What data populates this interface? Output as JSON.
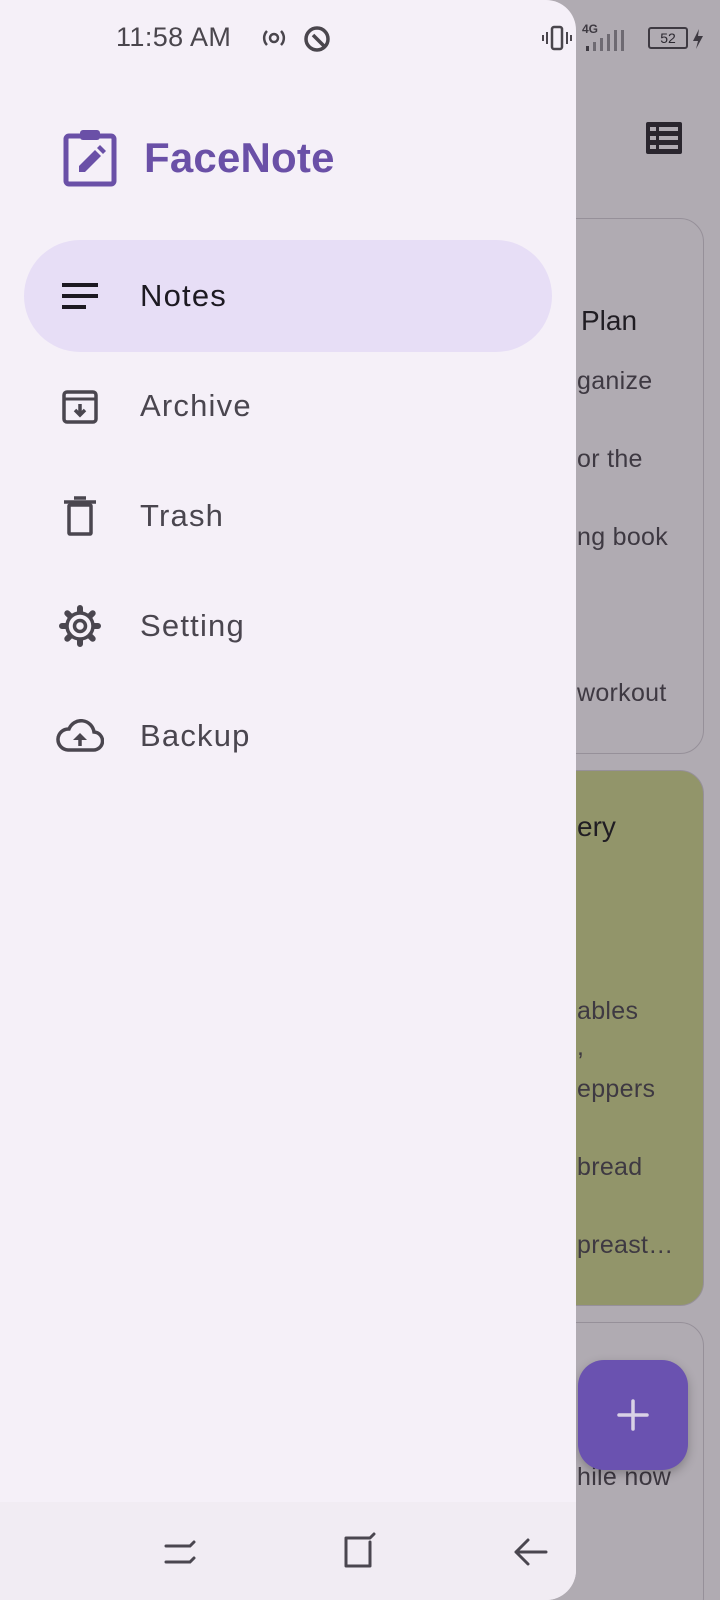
{
  "status_bar": {
    "time": "11:58 AM",
    "network": "4G",
    "battery": "52"
  },
  "drawer": {
    "app_name": "FaceNote",
    "brand_color": "#6a50a7",
    "active_bg": "#e7def6",
    "items": [
      {
        "label": "Notes",
        "icon": "notes-lines-icon",
        "active": true
      },
      {
        "label": "Archive",
        "icon": "archive-icon",
        "active": false
      },
      {
        "label": "Trash",
        "icon": "trash-icon",
        "active": false
      },
      {
        "label": "Setting",
        "icon": "gear-icon",
        "active": false
      },
      {
        "label": "Backup",
        "icon": "cloud-upload-icon",
        "active": false
      }
    ]
  },
  "background": {
    "cards": [
      {
        "title": "Plan",
        "lines": [
          "ganize",
          "or the",
          "ng book",
          "workout"
        ]
      },
      {
        "title": "ery",
        "color": "#c9d18a",
        "lines": [
          "ables",
          ",",
          "eppers",
          "bread",
          "preast…"
        ]
      },
      {
        "lines": [
          "hile now"
        ]
      }
    ],
    "fab": "plus-icon"
  }
}
